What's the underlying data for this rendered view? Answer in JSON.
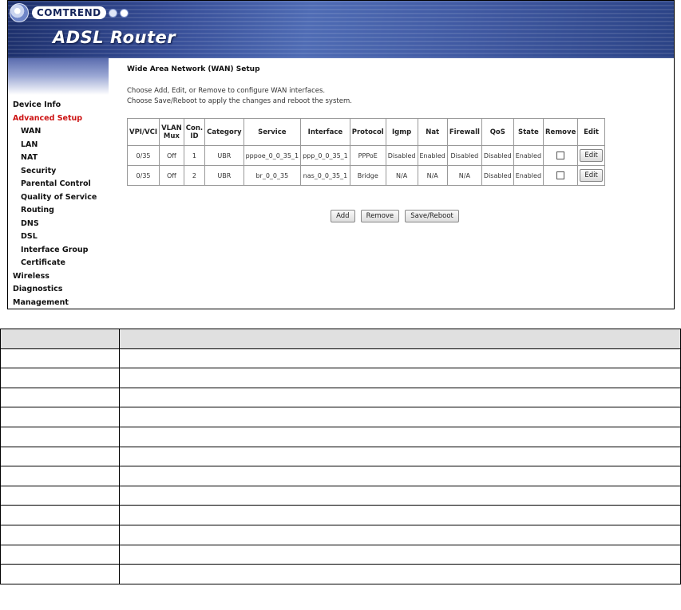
{
  "banner": {
    "brand": "COMTREND",
    "product": "ADSL Router"
  },
  "sidebar": {
    "items": [
      {
        "label": "Device Info",
        "level": "top",
        "active": false
      },
      {
        "label": "Advanced Setup",
        "level": "top",
        "active": true
      },
      {
        "label": "WAN",
        "level": "sub",
        "active": false
      },
      {
        "label": "LAN",
        "level": "sub",
        "active": false
      },
      {
        "label": "NAT",
        "level": "sub",
        "active": false
      },
      {
        "label": "Security",
        "level": "sub",
        "active": false
      },
      {
        "label": "Parental Control",
        "level": "sub",
        "active": false
      },
      {
        "label": "Quality of Service",
        "level": "sub",
        "active": false
      },
      {
        "label": "Routing",
        "level": "sub",
        "active": false
      },
      {
        "label": "DNS",
        "level": "sub",
        "active": false
      },
      {
        "label": "DSL",
        "level": "sub",
        "active": false
      },
      {
        "label": "Interface Group",
        "level": "sub",
        "active": false
      },
      {
        "label": "Certificate",
        "level": "sub",
        "active": false
      },
      {
        "label": "Wireless",
        "level": "top",
        "active": false
      },
      {
        "label": "Diagnostics",
        "level": "top",
        "active": false
      },
      {
        "label": "Management",
        "level": "top",
        "active": false
      }
    ],
    "active_color": "#cc1111"
  },
  "main": {
    "title": "Wide Area Network (WAN) Setup",
    "desc_line1": "Choose Add, Edit, or Remove to configure WAN interfaces.",
    "desc_line2": "Choose Save/Reboot to apply the changes and reboot the system.",
    "table": {
      "headers": [
        {
          "l1": "VPI/VCI",
          "l2": ""
        },
        {
          "l1": "VLAN",
          "l2": "Mux"
        },
        {
          "l1": "Con.",
          "l2": "ID"
        },
        {
          "l1": "Category",
          "l2": ""
        },
        {
          "l1": "Service",
          "l2": ""
        },
        {
          "l1": "Interface",
          "l2": ""
        },
        {
          "l1": "Protocol",
          "l2": ""
        },
        {
          "l1": "Igmp",
          "l2": ""
        },
        {
          "l1": "Nat",
          "l2": ""
        },
        {
          "l1": "Firewall",
          "l2": ""
        },
        {
          "l1": "QoS",
          "l2": ""
        },
        {
          "l1": "State",
          "l2": ""
        },
        {
          "l1": "Remove",
          "l2": ""
        },
        {
          "l1": "Edit",
          "l2": ""
        }
      ],
      "rows": [
        {
          "vpi_vci": "0/35",
          "vlan_mux": "Off",
          "con_id": "1",
          "category": "UBR",
          "service": "pppoe_0_0_35_1",
          "interface": "ppp_0_0_35_1",
          "protocol": "PPPoE",
          "igmp": "Disabled",
          "nat": "Enabled",
          "firewall": "Disabled",
          "qos": "Disabled",
          "state": "Enabled",
          "edit_label": "Edit"
        },
        {
          "vpi_vci": "0/35",
          "vlan_mux": "Off",
          "con_id": "2",
          "category": "UBR",
          "service": "br_0_0_35",
          "interface": "nas_0_0_35_1",
          "protocol": "Bridge",
          "igmp": "N/A",
          "nat": "N/A",
          "firewall": "N/A",
          "qos": "Disabled",
          "state": "Enabled",
          "edit_label": "Edit"
        }
      ]
    },
    "buttons": {
      "add": "Add",
      "remove": "Remove",
      "save_reboot": "Save/Reboot"
    }
  },
  "field_table": {
    "row_count": 13
  }
}
